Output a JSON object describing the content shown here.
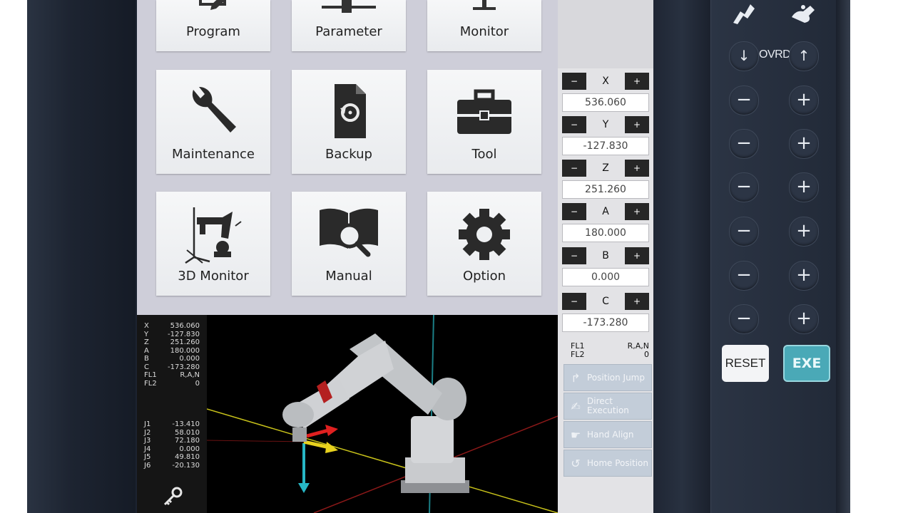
{
  "menu": {
    "tiles": [
      {
        "label": "Program",
        "icon": "program-icon"
      },
      {
        "label": "Parameter",
        "icon": "parameter-icon"
      },
      {
        "label": "Monitor",
        "icon": "monitor-icon"
      },
      {
        "label": "Maintenance",
        "icon": "wrench-icon"
      },
      {
        "label": "Backup",
        "icon": "backup-file-icon"
      },
      {
        "label": "Tool",
        "icon": "toolbox-icon"
      },
      {
        "label": "3D Monitor",
        "icon": "robot-arm-icon"
      },
      {
        "label": "Manual",
        "icon": "book-search-icon"
      },
      {
        "label": "Option",
        "icon": "gear-icon"
      }
    ]
  },
  "coords": {
    "minus_label": "−",
    "plus_label": "+",
    "axes": [
      {
        "name": "X",
        "value": "536.060"
      },
      {
        "name": "Y",
        "value": "-127.830"
      },
      {
        "name": "Z",
        "value": "251.260"
      },
      {
        "name": "A",
        "value": "180.000"
      },
      {
        "name": "B",
        "value": "0.000"
      },
      {
        "name": "C",
        "value": "-173.280"
      }
    ],
    "fl1_label": "FL1",
    "fl1_value": "R,A,N",
    "fl2_label": "FL2",
    "fl2_value": "0"
  },
  "functions": [
    {
      "label": "Position Jump",
      "icon": "position-jump-icon"
    },
    {
      "label": "Direct Execution",
      "icon": "direct-execution-icon"
    },
    {
      "label": "Hand Align",
      "icon": "hand-align-icon"
    },
    {
      "label": "Home Position",
      "icon": "home-position-icon"
    }
  ],
  "readout": {
    "rows": [
      {
        "k": "X",
        "v": "536.060"
      },
      {
        "k": "Y",
        "v": "-127.830"
      },
      {
        "k": "Z",
        "v": "251.260"
      },
      {
        "k": "A",
        "v": "180.000"
      },
      {
        "k": "B",
        "v": "0.000"
      },
      {
        "k": "C",
        "v": "-173.280"
      },
      {
        "k": "FL1",
        "v": "R,A,N"
      },
      {
        "k": "FL2",
        "v": "0"
      }
    ],
    "joints": [
      {
        "k": "J1",
        "v": "-13.410"
      },
      {
        "k": "J2",
        "v": "58.010"
      },
      {
        "k": "J3",
        "v": "72.180"
      },
      {
        "k": "J4",
        "v": "0.000"
      },
      {
        "k": "J5",
        "v": "49.810"
      },
      {
        "k": "J6",
        "v": "-20.130"
      }
    ]
  },
  "pendant": {
    "ovrd_label": "OVRD",
    "down_arrow": "↓",
    "up_arrow": "↑",
    "minus": "−",
    "plus": "+",
    "reset_label": "RESET",
    "exe_label": "EXE"
  },
  "colors": {
    "exe": "#4aa9b7",
    "tile": "#eef0f2",
    "screen_bg": "#ceced9"
  }
}
